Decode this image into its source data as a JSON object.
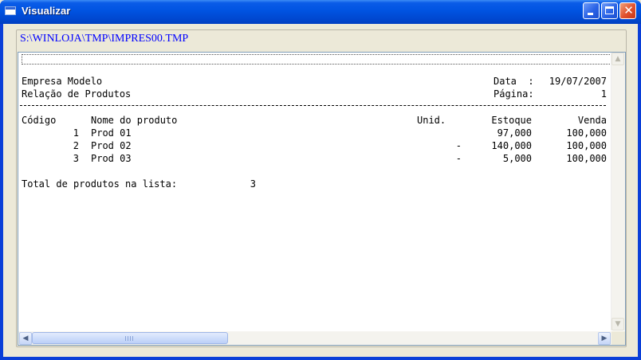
{
  "window": {
    "title": "Visualizar",
    "close_glyph": "✕"
  },
  "viewer": {
    "file_path": "S:\\WINLOJA\\TMP\\IMPRES00.TMP"
  },
  "report": {
    "company": "Empresa Modelo",
    "report_title": "Relação de Produtos",
    "date_label": "Data  :",
    "date_value": "19/07/2007",
    "page_label": "Página:",
    "page_value": "1",
    "columns": {
      "code": "Código",
      "name": "Nome do produto",
      "unit": "Unid.",
      "stock": "Estoque",
      "price": "Venda"
    },
    "rows": [
      {
        "code": "1",
        "name": "Prod 01",
        "unit": "",
        "stock": "97,000",
        "price": "100,000"
      },
      {
        "code": "2",
        "name": "Prod 02",
        "unit": "-",
        "stock": "140,000",
        "price": "100,000"
      },
      {
        "code": "3",
        "name": "Prod 03",
        "unit": "-",
        "stock": "5,000",
        "price": "100,000"
      }
    ],
    "total_label": "Total de produtos na lista:",
    "total_value": "3"
  },
  "scrollbars": {
    "up": "▲",
    "down": "▼",
    "left": "◀",
    "right": "▶"
  }
}
